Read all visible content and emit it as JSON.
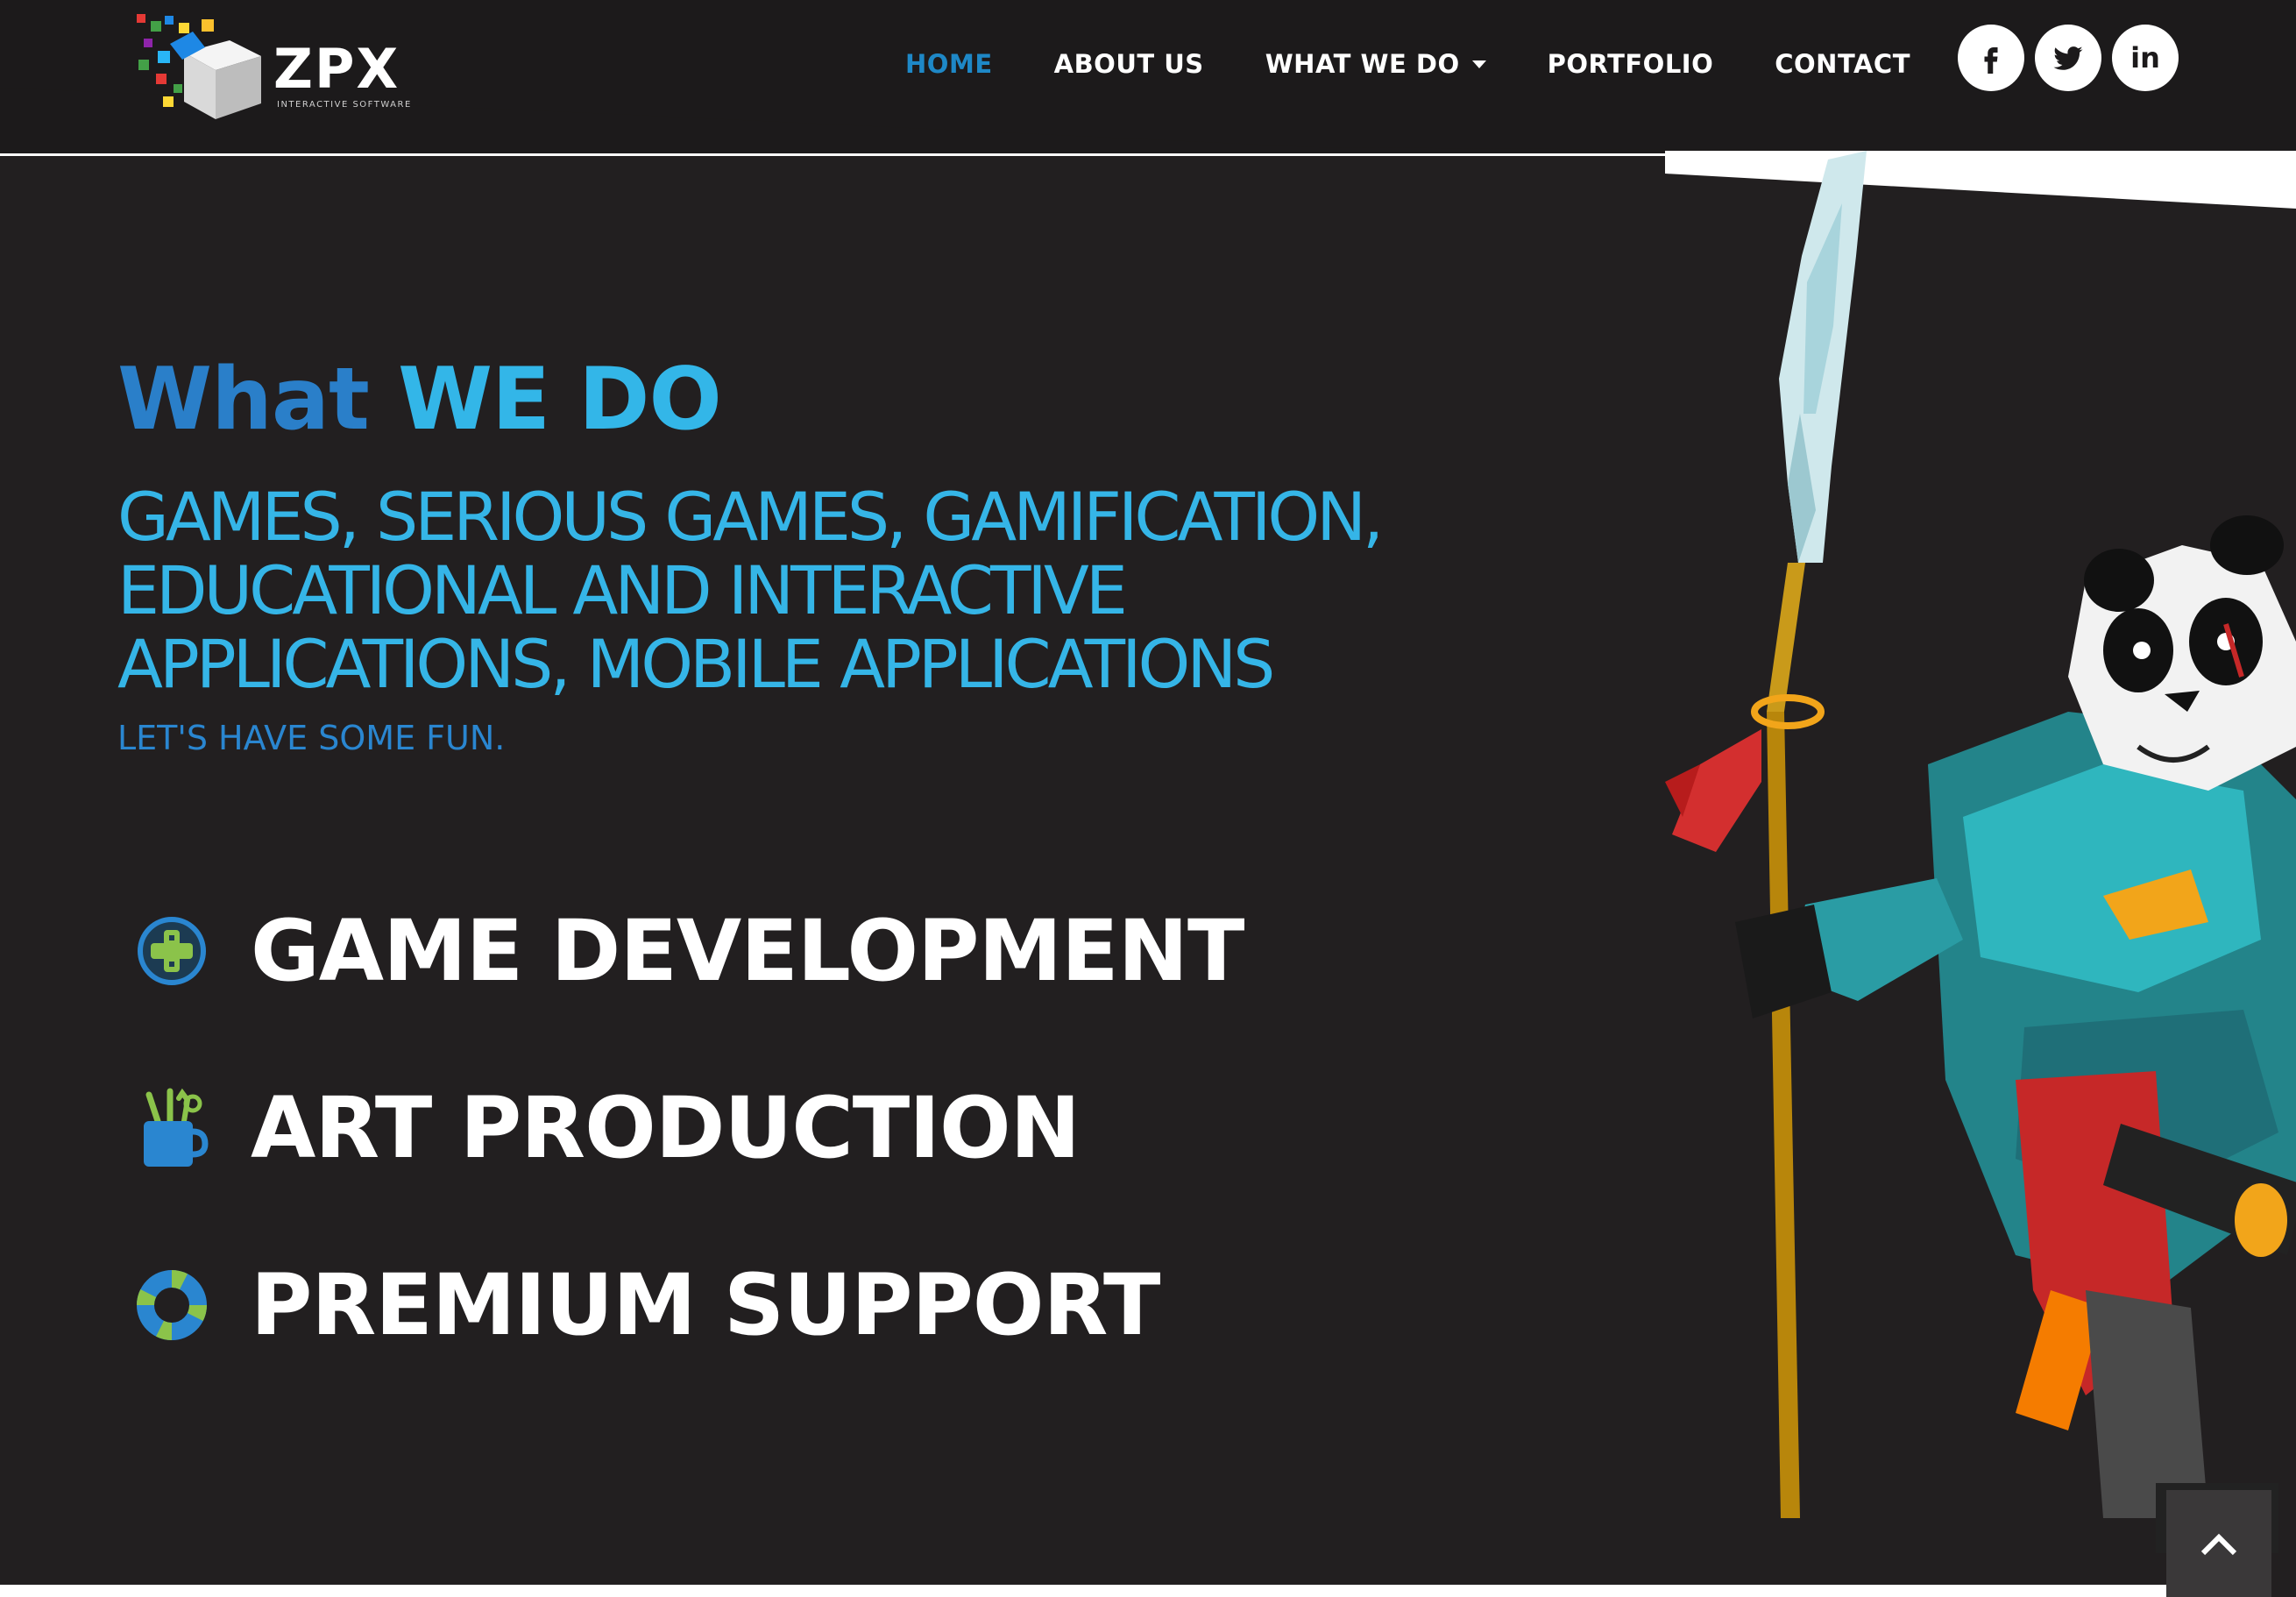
{
  "brand": {
    "name": "ZPX",
    "tagline": "INTERACTIVE SOFTWARE"
  },
  "nav": {
    "items": [
      {
        "label": "HOME",
        "active": true
      },
      {
        "label": "ABOUT US",
        "active": false
      },
      {
        "label": "WHAT WE DO",
        "active": false,
        "has_dropdown": true
      },
      {
        "label": "PORTFOLIO",
        "active": false
      },
      {
        "label": "CONTACT",
        "active": false
      }
    ]
  },
  "social": {
    "links": [
      {
        "icon": "facebook-icon",
        "label": "f"
      },
      {
        "icon": "twitter-icon",
        "label": ""
      },
      {
        "icon": "linkedin-icon",
        "label": "in"
      }
    ]
  },
  "hero": {
    "title_part1": "What",
    "title_part2": "WE DO",
    "subtitle_lines": [
      "GAMES, SERIOUS GAMES, GAMIFICATION,",
      "EDUCATIONAL AND INTERACTIVE",
      "APPLICATIONS, MOBILE APPLICATIONS"
    ],
    "tagline": "LET'S HAVE SOME FUN."
  },
  "services": [
    {
      "label": "GAME DEVELOPMENT",
      "icon": "gamepad-plus-icon"
    },
    {
      "label": "ART PRODUCTION",
      "icon": "art-supplies-cup-icon"
    },
    {
      "label": "PREMIUM SUPPORT",
      "icon": "lifebuoy-icon"
    }
  ],
  "colors": {
    "accent_blue": "#2a7fc9",
    "light_blue": "#33b6e8",
    "background": "#221f20",
    "header_bg": "#1c1a1b"
  },
  "scroll_top": {
    "icon": "chevron-up-icon"
  }
}
